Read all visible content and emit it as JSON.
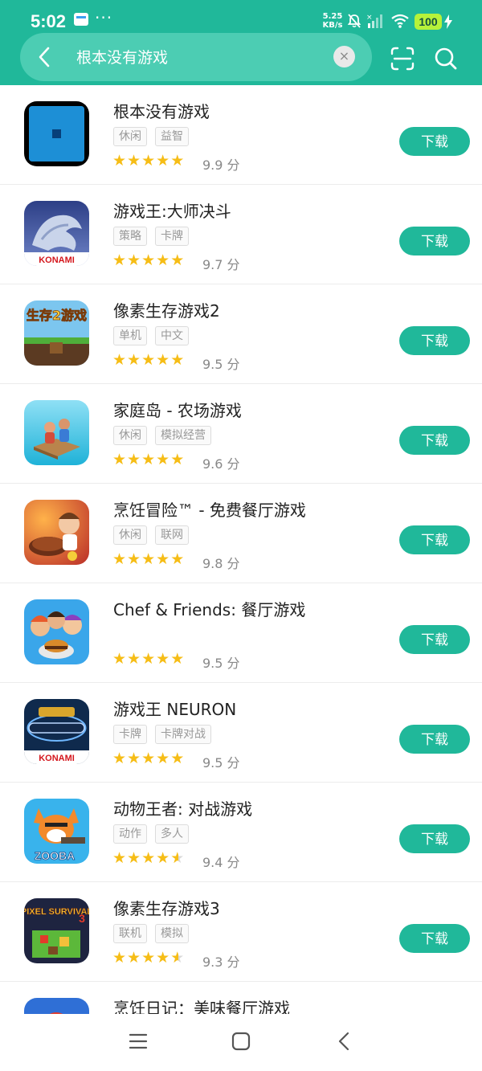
{
  "status": {
    "time": "5:02",
    "dots": "···",
    "net_speed_value": "5.25",
    "net_speed_unit": "KB/s",
    "battery": "100"
  },
  "search": {
    "query": "根本没有游戏",
    "clear": "×"
  },
  "apps": [
    {
      "name": "根本没有游戏",
      "tags": [
        "休闲",
        "益智"
      ],
      "rating": 9.9,
      "score": "9.9 分",
      "stars": 5,
      "button": "下载",
      "icon": "blank-game-icon"
    },
    {
      "name": "游戏王:大师决斗",
      "tags": [
        "策略",
        "卡牌"
      ],
      "rating": 9.7,
      "score": "9.7 分",
      "stars": 5,
      "button": "下载",
      "icon": "yugioh-master-duel-icon",
      "icon_text": "KONAMI"
    },
    {
      "name": "像素生存游戏2",
      "tags": [
        "单机",
        "中文"
      ],
      "rating": 9.5,
      "score": "9.5 分",
      "stars": 5,
      "button": "下载",
      "icon": "pixel-survival-2-icon",
      "icon_text": "生存2游戏"
    },
    {
      "name": "家庭岛 - 农场游戏",
      "tags": [
        "休闲",
        "模拟经营"
      ],
      "rating": 9.6,
      "score": "9.6 分",
      "stars": 5,
      "button": "下载",
      "icon": "family-island-icon"
    },
    {
      "name": "烹饪冒险™ - 免费餐厅游戏",
      "tags": [
        "休闲",
        "联网"
      ],
      "rating": 9.8,
      "score": "9.8 分",
      "stars": 5,
      "button": "下载",
      "icon": "cooking-adventure-icon"
    },
    {
      "name": "Chef & Friends: 餐厅游戏",
      "tags": [],
      "rating": 9.5,
      "score": "9.5 分",
      "stars": 5,
      "button": "下载",
      "icon": "chef-friends-icon"
    },
    {
      "name": "游戏王 NEURON",
      "tags": [
        "卡牌",
        "卡牌对战"
      ],
      "rating": 9.5,
      "score": "9.5 分",
      "stars": 5,
      "button": "下载",
      "icon": "yugioh-neuron-icon",
      "icon_text": "KONAMI"
    },
    {
      "name": "动物王者: 对战游戏",
      "tags": [
        "动作",
        "多人"
      ],
      "rating": 9.4,
      "score": "9.4 分",
      "stars": 4.5,
      "button": "下载",
      "icon": "zooba-icon",
      "icon_text": "ZOOBA"
    },
    {
      "name": "像素生存游戏3",
      "tags": [
        "联机",
        "模拟"
      ],
      "rating": 9.3,
      "score": "9.3 分",
      "stars": 4.5,
      "button": "下载",
      "icon": "pixel-survival-3-icon",
      "icon_text": "PIXEL SURVIVAL"
    },
    {
      "name": "烹饪日记：美味餐厅游戏",
      "tags": [],
      "rating": null,
      "score": "",
      "stars": 0,
      "button": "",
      "icon": "cooking-diary-icon"
    }
  ],
  "colors": {
    "accent": "#20b89a",
    "star": "#f6bd16"
  }
}
